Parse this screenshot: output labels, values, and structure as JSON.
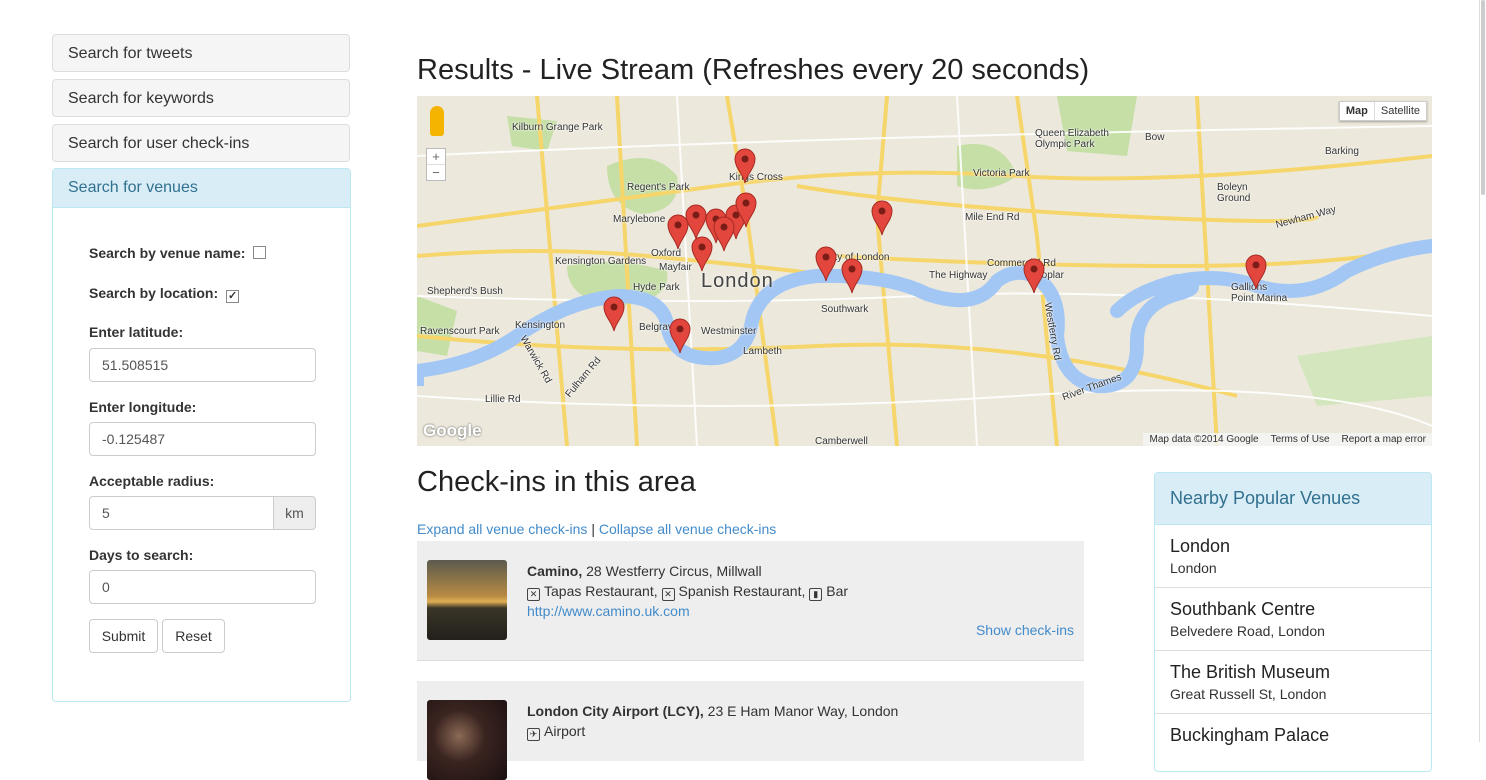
{
  "accordion": {
    "tweets": "Search for tweets",
    "keywords": "Search for keywords",
    "checkins": "Search for user check-ins",
    "venues": "Search for venues"
  },
  "form": {
    "by_name_label": "Search by venue name:",
    "by_name_checked": false,
    "by_location_label": "Search by location:",
    "by_location_checked": true,
    "lat_label": "Enter latitude:",
    "lat_value": "51.508515",
    "lng_label": "Enter longitude:",
    "lng_value": "-0.125487",
    "radius_label": "Acceptable radius:",
    "radius_value": "5",
    "radius_unit": "km",
    "days_label": "Days to search:",
    "days_value": "0",
    "submit": "Submit",
    "reset": "Reset"
  },
  "results_title": "Results - Live Stream (Refreshes every 20 seconds)",
  "map": {
    "type_map": "Map",
    "type_satellite": "Satellite",
    "attribution": "Map data ©2014 Google",
    "terms": "Terms of Use",
    "report": "Report a map error",
    "logo": "Google",
    "zoom_in": "+",
    "zoom_out": "−",
    "center_label": "London",
    "labels": [
      "Kilburn Grange Park",
      "Regent's Park",
      "Kings Cross",
      "Marylebone",
      "Kensington Gardens",
      "Hyde Park",
      "Mayfair",
      "Oxford",
      "Shepherd's Bush",
      "Ravenscourt Park",
      "Kensington",
      "Belgravia",
      "Westminster",
      "Lambeth",
      "City of London",
      "Southwark",
      "Victoria Park",
      "Queen Elizabeth Olympic Park",
      "Bow",
      "Barking",
      "Boleyn Ground",
      "Mile End Rd",
      "The Highway",
      "Commercial Rd",
      "Poplar",
      "Westferry Rd",
      "River Thames",
      "Gallions Point Marina",
      "Newham Way",
      "Camberwell",
      "Fulham Rd",
      "Warwick Rd",
      "Lillie Rd"
    ],
    "marker_color": "#e2463c"
  },
  "checkins_title": "Check-ins in this area",
  "links": {
    "expand": "Expand all venue check-ins",
    "sep": " | ",
    "collapse": "Collapse all venue check-ins"
  },
  "venues": [
    {
      "name": "Camino,",
      "address": " 28 Westferry Circus, Millwall",
      "categories": "Tapas Restaurant, ",
      "categories2": "Spanish Restaurant, ",
      "categories3": "Bar",
      "url": "http://www.camino.uk.com",
      "show": "Show check-ins"
    },
    {
      "name": "London City Airport (LCY),",
      "address": " 23 E Ham Manor Way, London",
      "categories": "Airport"
    }
  ],
  "popular": {
    "title": "Nearby Popular Venues",
    "items": [
      {
        "name": "London",
        "address": "London"
      },
      {
        "name": "Southbank Centre",
        "address": "Belvedere Road, London"
      },
      {
        "name": "The British Museum",
        "address": "Great Russell St, London"
      },
      {
        "name": "Buckingham Palace",
        "address": ""
      }
    ]
  }
}
